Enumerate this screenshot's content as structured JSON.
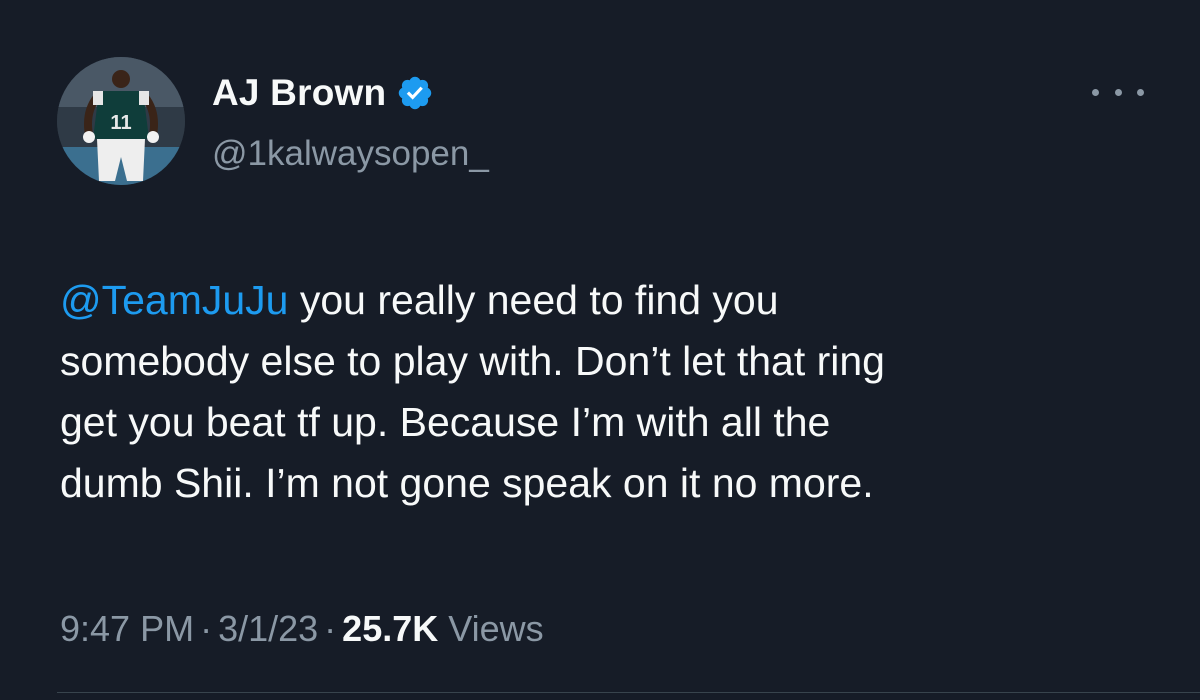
{
  "author": {
    "display_name": "AJ Brown",
    "handle": "@1kalwaysopen_",
    "verified": true,
    "avatar_jersey_number": "11"
  },
  "tweet": {
    "mention": "@TeamJuJu",
    "body": " you really need to find you\nsomebody else to play with. Don’t let that ring\nget you beat tf up. Because I’m with all the\ndumb Shii. I’m not gone speak on it no more."
  },
  "meta": {
    "time": "9:47 PM",
    "separator": "·",
    "date": "3/1/23",
    "views_count": "25.7K",
    "views_label": "Views"
  },
  "icons": {
    "verified": "verified-badge-icon",
    "more": "more-options-icon"
  },
  "colors": {
    "background": "#161c27",
    "text": "#f7f9f9",
    "secondary": "#8b98a5",
    "accent": "#1d9bf0"
  }
}
